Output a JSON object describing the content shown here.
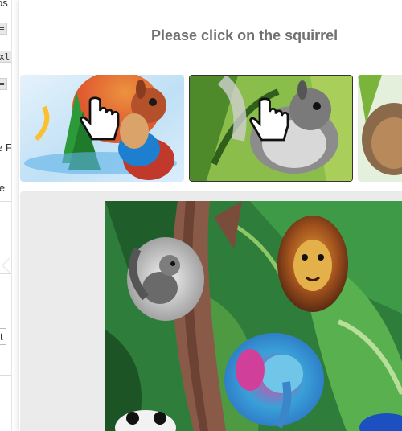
{
  "background_page": {
    "fragments": [
      "os",
      "=",
      "xl",
      "=",
      "e F",
      "ie",
      "t"
    ]
  },
  "captcha": {
    "prompt": "Please click on the squirrel",
    "thumbnails": [
      {
        "subject": "squirrel",
        "hint": "pointer-hand-icon"
      },
      {
        "subject": "squirrel",
        "hint": "pointer-hand-icon"
      },
      {
        "subject": "hedgehog"
      }
    ],
    "main_image_subjects": [
      "squirrel",
      "lion",
      "elephant",
      "panda"
    ]
  },
  "colors": {
    "prompt_text": "#707070",
    "panel_bg": "#ebebeb",
    "jungle_green": "#2f7d3a"
  }
}
